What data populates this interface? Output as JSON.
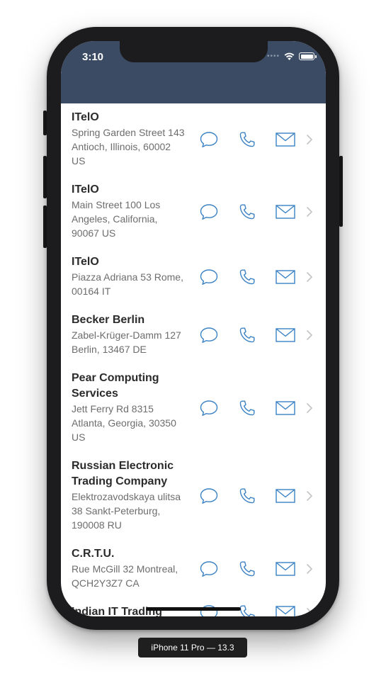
{
  "status_bar": {
    "time": "3:10"
  },
  "contacts": [
    {
      "name": "ITelO",
      "address": "Spring Garden Street 143 Antioch, Illinois, 60002 US"
    },
    {
      "name": "ITelO",
      "address": "Main Street 100 Los Angeles, California, 90067 US"
    },
    {
      "name": "ITelO",
      "address": "Piazza Adriana 53 Rome, 00164 IT"
    },
    {
      "name": "Becker Berlin",
      "address": "Zabel-Krüger-Damm 127 Berlin, 13467 DE"
    },
    {
      "name": "Pear Computing Services",
      "address": "Jett Ferry Rd 8315 Atlanta, Georgia, 30350 US"
    },
    {
      "name": "Russian Electronic Trading Company",
      "address": "Elektrozavodskaya ulitsa 38 Sankt-Peterburg, 190008 RU"
    },
    {
      "name": "C.R.T.U.",
      "address": "Rue McGill 32 Montreal, QCH2Y3Z7 CA"
    },
    {
      "name": "Indian IT Trading",
      "address": ""
    }
  ],
  "device_label": "iPhone 11 Pro — 13.3",
  "colors": {
    "nav_bar": "#3a4b63",
    "accent": "#3b82c4"
  },
  "icons": {
    "message": "message-icon",
    "phone": "phone-icon",
    "email": "email-icon",
    "disclosure": "chevron-right-icon"
  }
}
